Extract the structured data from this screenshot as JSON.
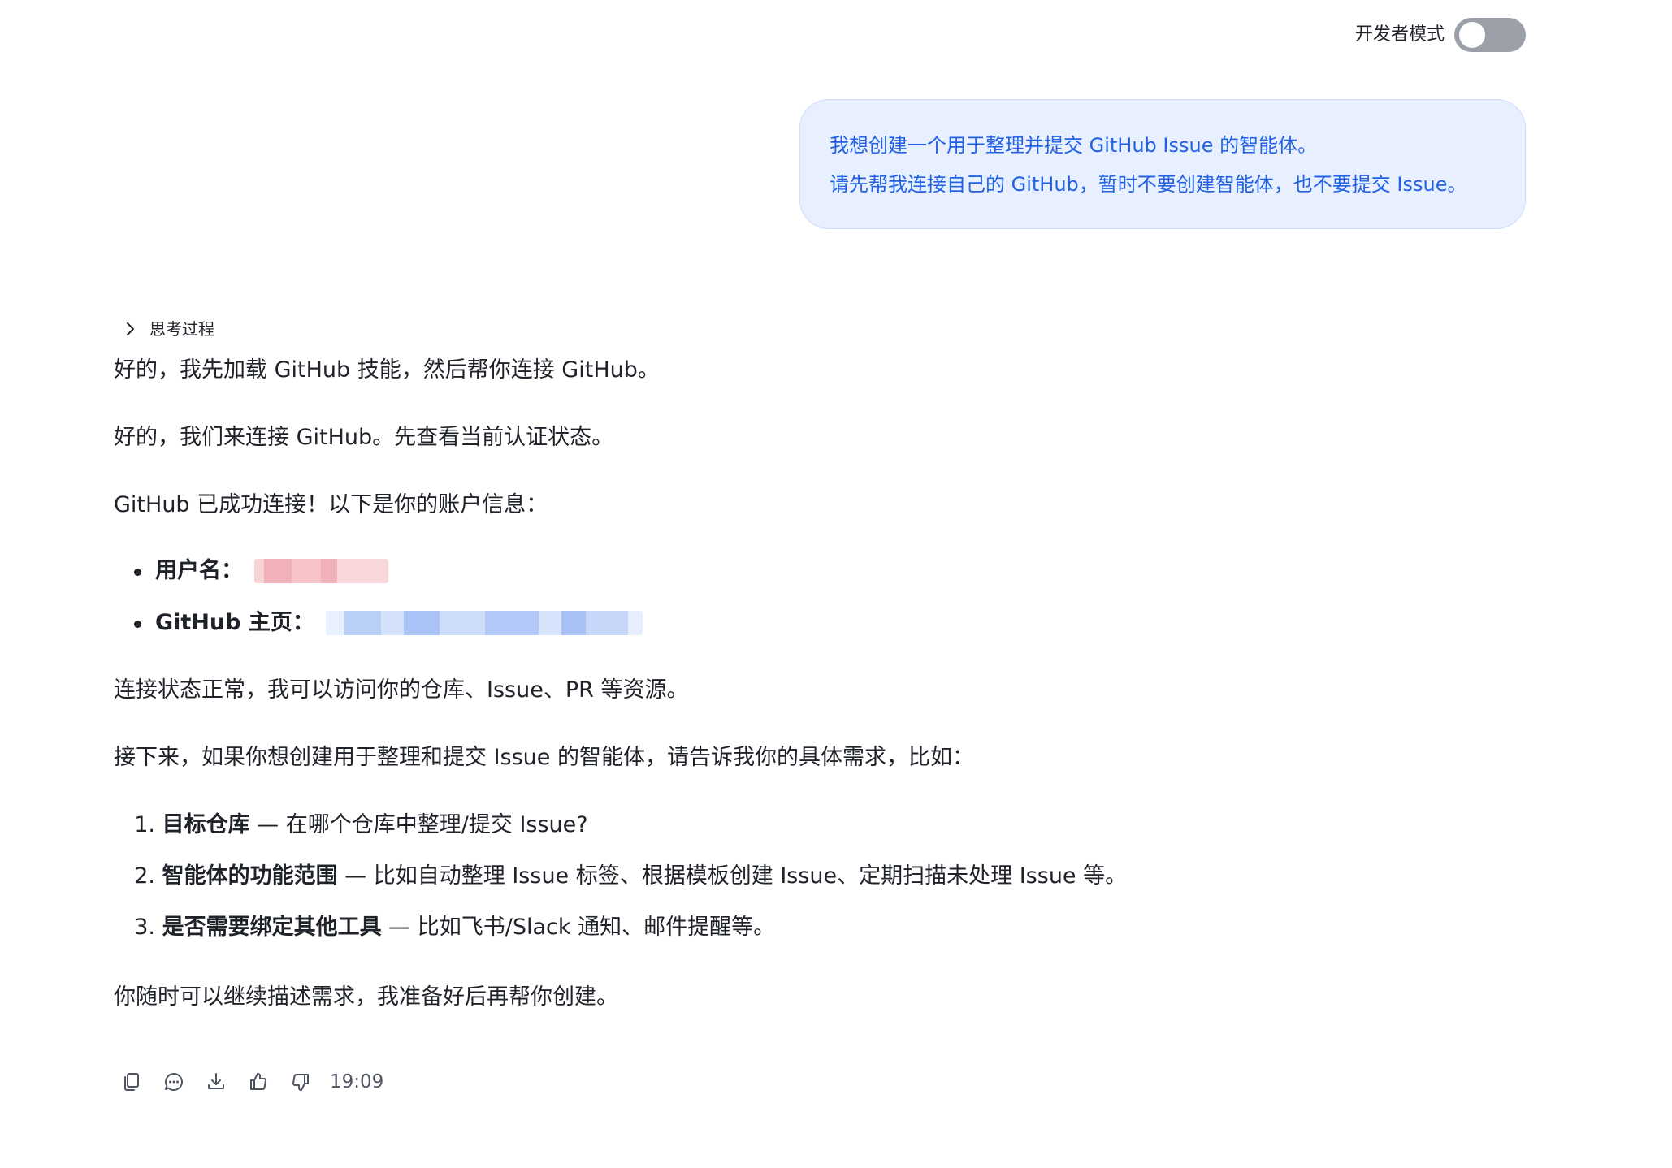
{
  "header": {
    "dev_mode_label": "开发者模式",
    "dev_mode_on": false
  },
  "user_message": {
    "lines": [
      "我想创建一个用于整理并提交 GitHub Issue 的智能体。",
      "请先帮我连接自己的 GitHub，暂时不要创建智能体，也不要提交 Issue。"
    ]
  },
  "assistant": {
    "thinking_label": "思考过程",
    "paragraphs": [
      "好的，我先加载 GitHub 技能，然后帮你连接 GitHub。",
      "好的，我们来连接 GitHub。先查看当前认证状态。",
      "GitHub 已成功连接！以下是你的账户信息：",
      "连接状态正常，我可以访问你的仓库、Issue、PR 等资源。",
      "接下来，如果你想创建用于整理和提交 Issue 的智能体，请告诉我你的具体需求，比如：",
      "你随时可以继续描述需求，我准备好后再帮你创建。"
    ],
    "account_items": [
      {
        "label": "用户名："
      },
      {
        "label": "GitHub 主页："
      }
    ],
    "requirements": [
      {
        "number": "1.",
        "title": "目标仓库",
        "detail": " — 在哪个仓库中整理/提交 Issue?"
      },
      {
        "number": "2.",
        "title": "智能体的功能范围",
        "detail": " — 比如自动整理 Issue 标签、根据模板创建 Issue、定期扫描未处理 Issue 等。"
      },
      {
        "number": "3.",
        "title": "是否需要绑定其他工具",
        "detail": " — 比如飞书/Slack 通知、邮件提醒等。"
      }
    ]
  },
  "actions": {
    "icons": [
      "copy-icon",
      "comment-icon",
      "download-icon",
      "thumbs-up-icon",
      "thumbs-down-icon"
    ],
    "timestamp": "19:09"
  },
  "colors": {
    "user_bubble_bg": "#e8efff",
    "user_bubble_text": "#2162e3",
    "toggle_off": "#9ba0a8",
    "body_text": "#1f2329"
  }
}
